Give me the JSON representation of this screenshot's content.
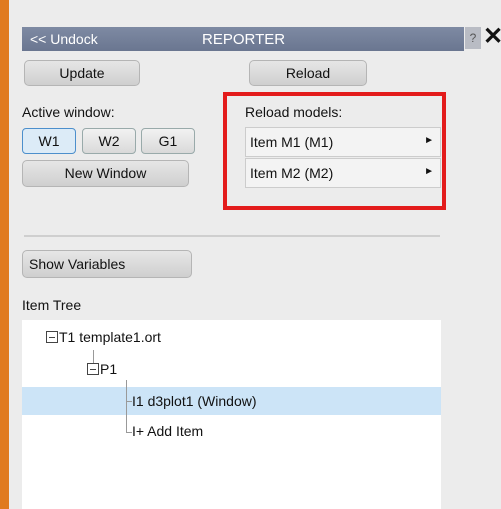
{
  "window": {
    "undock_label": "<< Undock",
    "title": "REPORTER",
    "help_label": "?",
    "close_label": "✕"
  },
  "toolbar": {
    "update_label": "Update",
    "reload_label": "Reload"
  },
  "active_window": {
    "label": "Active window:",
    "buttons": [
      "W1",
      "W2",
      "G1"
    ],
    "active": "W1",
    "new_window_label": "New Window"
  },
  "reload_models": {
    "label": "Reload models:",
    "items": [
      "Item M1 (M1)",
      "Item M2 (M2)"
    ]
  },
  "variables": {
    "show_label": "Show Variables"
  },
  "item_tree": {
    "label": "Item Tree",
    "nodes": {
      "template": "T1 template1.ort",
      "page": "P1",
      "item": "I1 d3plot1 (Window)",
      "add": "I+ Add Item"
    }
  },
  "colors": {
    "accent_orange": "#e07a1f",
    "highlight_red": "#e31b1b",
    "selection_blue": "#cce4f7",
    "titlebar": "#6a7690"
  }
}
